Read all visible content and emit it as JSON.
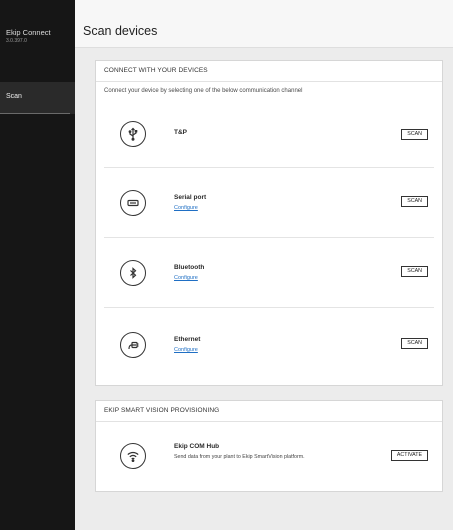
{
  "app": {
    "title": "Ekip Connect",
    "version": "3.0.397.0"
  },
  "sidebar": {
    "items": [
      {
        "label": "Scan",
        "active": true
      }
    ]
  },
  "header": {
    "title": "Scan devices"
  },
  "connect_card": {
    "title": "CONNECT WITH YOUR DEVICES",
    "description": "Connect your device by selecting one of the below communication channel",
    "devices": [
      {
        "name": "T&P",
        "icon": "usb-icon",
        "button": "SCAN"
      },
      {
        "name": "Serial port",
        "link": "Configure",
        "icon": "serial-port-icon",
        "button": "SCAN"
      },
      {
        "name": "Bluetooth",
        "link": "Configure",
        "icon": "bluetooth-icon",
        "button": "SCAN"
      },
      {
        "name": "Ethernet",
        "link": "Configure",
        "icon": "ethernet-icon",
        "button": "SCAN"
      }
    ]
  },
  "provisioning_card": {
    "title": "EKIP SMART VISION PROVISIONING",
    "item": {
      "name": "Ekip COM Hub",
      "description": "Send data from your plant to Ekip SmartVision platform.",
      "icon": "wifi-icon",
      "button": "ACTIVATE"
    }
  }
}
